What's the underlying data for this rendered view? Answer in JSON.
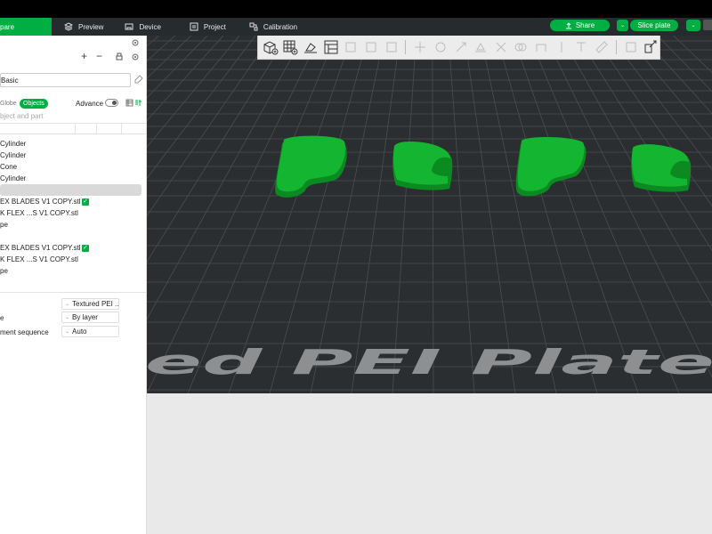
{
  "topbar": {
    "tabs": [
      {
        "label": "pare",
        "icon": "prepare-icon",
        "active": true
      },
      {
        "label": "Preview",
        "icon": "preview-icon"
      },
      {
        "label": "Device",
        "icon": "device-icon"
      },
      {
        "label": "Project",
        "icon": "project-icon"
      },
      {
        "label": "Calibration",
        "icon": "calibration-icon"
      }
    ],
    "share_label": "Share",
    "slice_label": "Slice plate"
  },
  "left_panel": {
    "preset": "Basic",
    "toggle_global": "Globe",
    "toggle_objects": "Objects",
    "advance_label": "Advance",
    "search_placeholder": "bject and part",
    "objects": [
      {
        "name": "Cylinder",
        "checked": false,
        "selected": false
      },
      {
        "name": "Cylinder",
        "checked": false,
        "selected": false
      },
      {
        "name": "Cone",
        "checked": false,
        "selected": false
      },
      {
        "name": "Cylinder",
        "checked": false,
        "selected": false
      },
      {
        "name": "",
        "checked": false,
        "selected": true
      },
      {
        "name": "EX BLADES V1 COPY.stl",
        "checked": true,
        "selected": false
      },
      {
        "name": "K FLEX ...S V1 COPY.stl",
        "checked": false,
        "selected": false
      },
      {
        "name": "pe",
        "checked": false,
        "selected": false
      },
      {
        "name": "",
        "checked": false,
        "selected": false
      },
      {
        "name": "EX BLADES V1 COPY.stl",
        "checked": true,
        "selected": false
      },
      {
        "name": "K FLEX ...S V1 COPY.stl",
        "checked": false,
        "selected": false
      },
      {
        "name": "pe",
        "checked": false,
        "selected": false
      }
    ],
    "plate_settings": [
      {
        "label": "",
        "value": "Textured PEI ..."
      },
      {
        "label": "e",
        "value": "By layer"
      },
      {
        "label": "ment sequence",
        "value": "Auto"
      }
    ]
  },
  "viewport": {
    "plate_text": "ed PEI Plate",
    "colors": {
      "plate": "#2b2e30",
      "grid": "#4a4e51",
      "model": "#11a52b",
      "floor": "#e9e9e9"
    }
  }
}
